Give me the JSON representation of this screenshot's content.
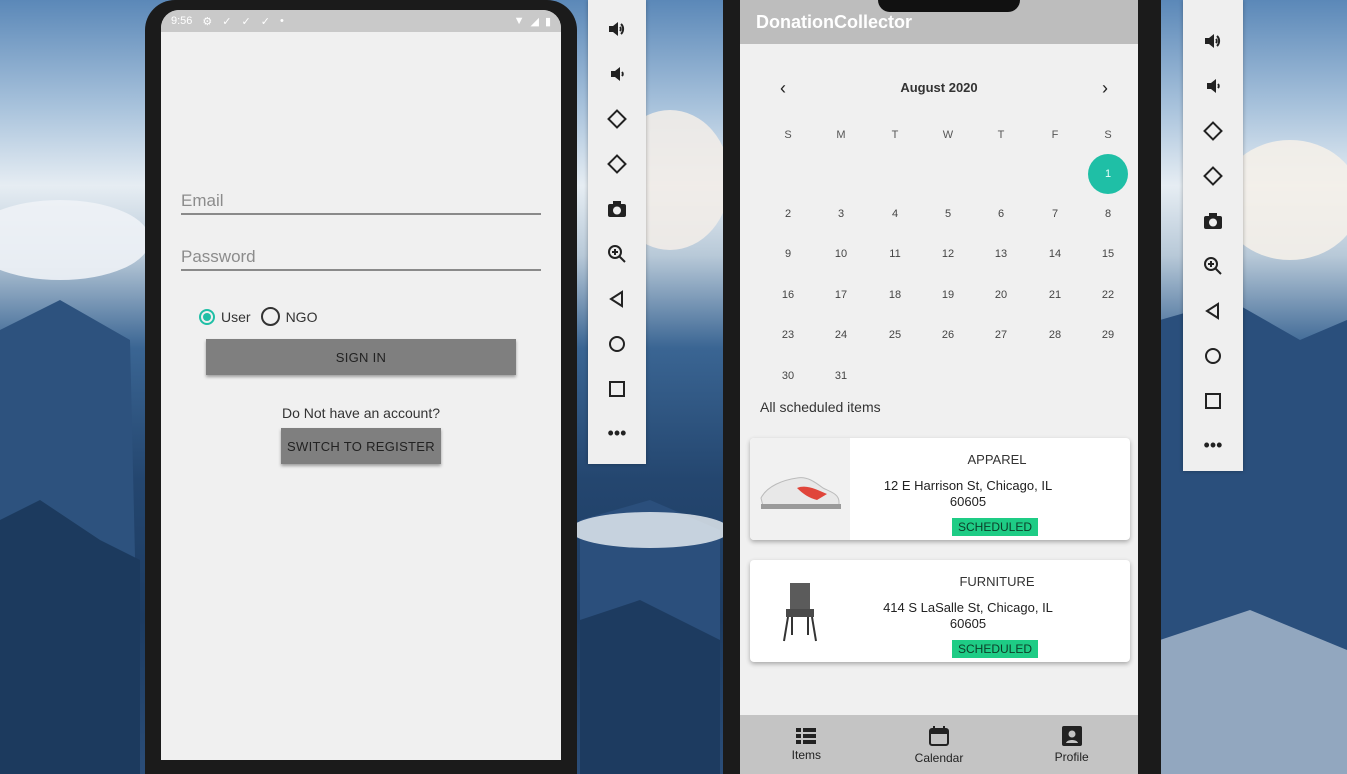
{
  "login": {
    "status_time": "9:56",
    "email_placeholder": "Email",
    "password_placeholder": "Password",
    "role_user": "User",
    "role_ngo": "NGO",
    "sign_in_label": "SIGN IN",
    "no_account_text": "Do Not have an account?",
    "switch_label": "SWITCH TO REGISTER"
  },
  "calendar_app": {
    "app_title": "DonationCollector",
    "month_label": "August 2020",
    "weekdays": [
      "S",
      "M",
      "T",
      "W",
      "T",
      "F",
      "S"
    ],
    "selected_day": "1",
    "days": [
      "2",
      "3",
      "4",
      "5",
      "6",
      "7",
      "8",
      "9",
      "10",
      "11",
      "12",
      "13",
      "14",
      "15",
      "16",
      "17",
      "18",
      "19",
      "20",
      "21",
      "22",
      "23",
      "24",
      "25",
      "26",
      "27",
      "28",
      "29",
      "30",
      "31"
    ],
    "section_label": "All scheduled items",
    "items": [
      {
        "category": "APPAREL",
        "address_line1": "12 E Harrison St, Chicago, IL",
        "address_line2": "60605",
        "status": "SCHEDULED",
        "icon": "sneaker-icon"
      },
      {
        "category": "FURNITURE",
        "address_line1": "414 S LaSalle St, Chicago, IL",
        "address_line2": "60605",
        "status": "SCHEDULED",
        "icon": "chair-icon"
      }
    ],
    "nav": {
      "items": "Items",
      "calendar": "Calendar",
      "profile": "Profile"
    }
  },
  "colors": {
    "accent": "#1fbfa6",
    "badge": "#1ecc85"
  }
}
